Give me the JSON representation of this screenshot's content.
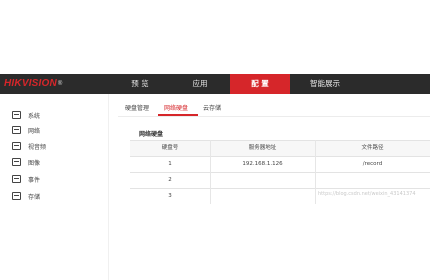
{
  "brand": {
    "logo_text": "HIKVISION",
    "logo_mark": "®",
    "logo_color": "#d6262a"
  },
  "top_nav": {
    "items": [
      {
        "label": "预 览"
      },
      {
        "label": "应用"
      },
      {
        "label": "配 置",
        "active": true
      },
      {
        "label": "智能展示"
      }
    ],
    "bar_color": "#2b2b2b",
    "active_color": "#d6262a"
  },
  "sidebar": {
    "items": [
      {
        "label": "系统",
        "icon": "monitor-icon"
      },
      {
        "label": "网络",
        "icon": "network-icon"
      },
      {
        "label": "视音频",
        "icon": "video-icon"
      },
      {
        "label": "图像",
        "icon": "image-icon"
      },
      {
        "label": "事件",
        "icon": "calendar-icon"
      },
      {
        "label": "存储",
        "icon": "storage-icon"
      }
    ]
  },
  "subtabs": [
    {
      "label": "硬盘管理"
    },
    {
      "label": "网络硬盘",
      "active": true
    },
    {
      "label": "云存储"
    }
  ],
  "section_title": "网络硬盘",
  "table": {
    "columns": [
      "硬盘号",
      "服务器地址",
      "文件路径"
    ],
    "rows": [
      [
        "1",
        "192.168.1.126",
        "/record"
      ],
      [
        "2",
        "",
        ""
      ],
      [
        "3",
        "",
        ""
      ]
    ]
  },
  "watermark": "https://blog.csdn.net/weixin_43141374"
}
